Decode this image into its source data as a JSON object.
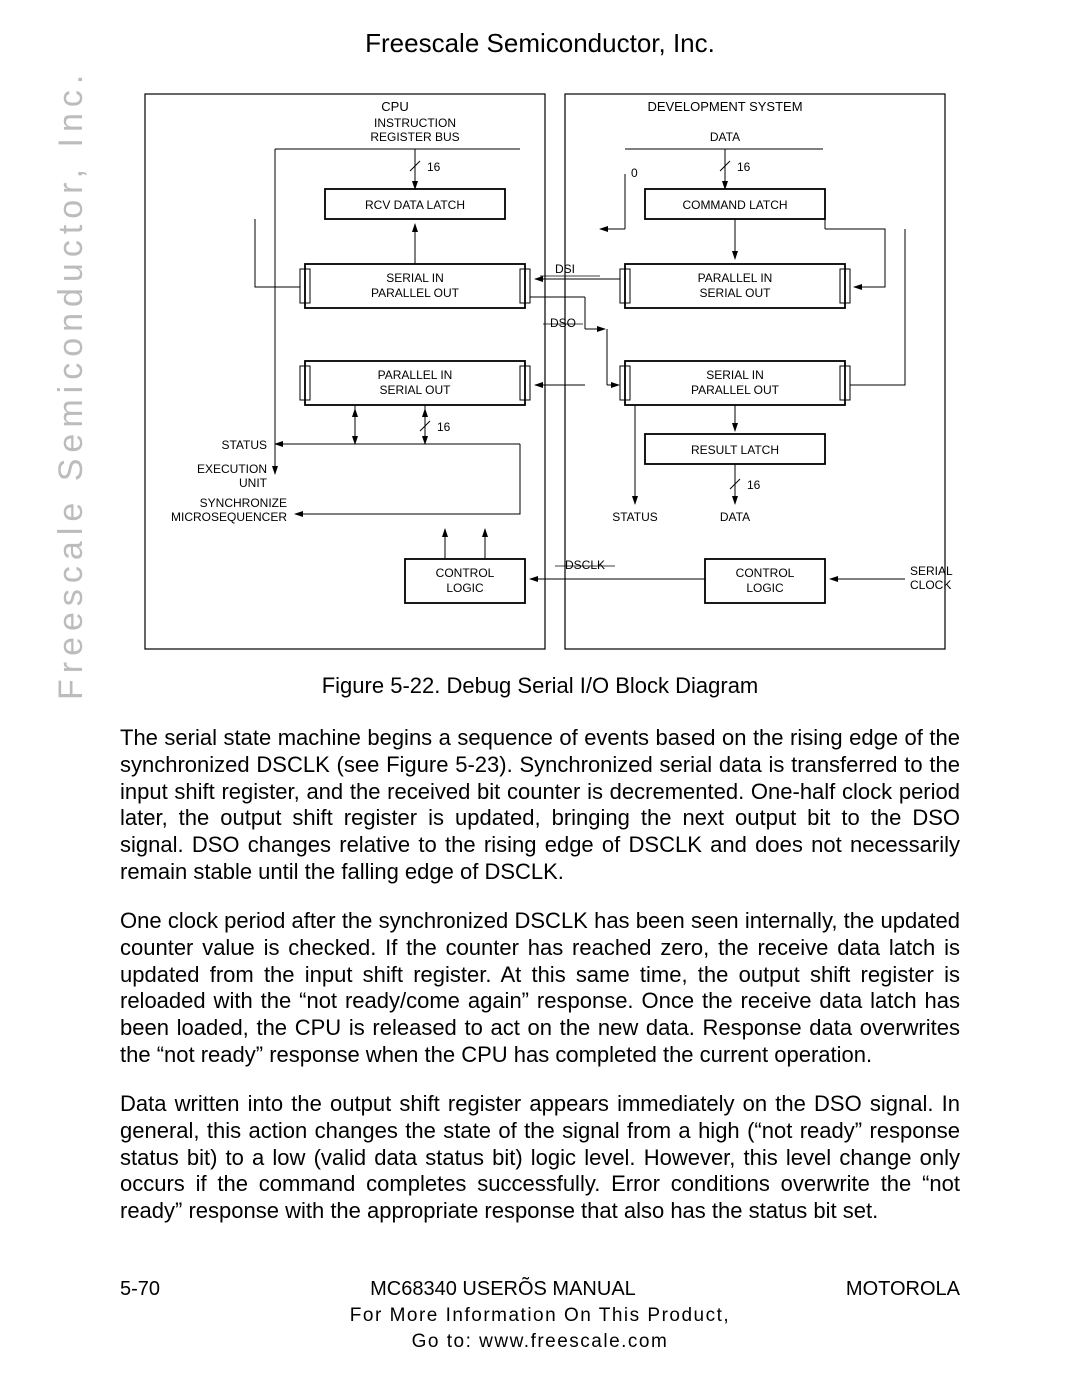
{
  "header": "Freescale Semiconductor, Inc.",
  "watermark": "Freescale Semiconductor, Inc.",
  "caption": "Figure 5-22. Debug Serial I/O Block Diagram",
  "diagram": {
    "left_title": "CPU",
    "right_title": "DEVELOPMENT SYSTEM",
    "instr_bus1": "INSTRUCTION",
    "instr_bus2": "REGISTER BUS",
    "bus_w_16a": "16",
    "zero": "0",
    "data_lbl": "DATA",
    "bus_w_16b": "16",
    "rcv_latch": "RCV DATA LATCH",
    "cmd_latch": "COMMAND LATCH",
    "si_po_l1": "SERIAL IN",
    "si_po_l2": "PARALLEL OUT",
    "pi_so_r1": "PARALLEL IN",
    "pi_so_r2": "SERIAL OUT",
    "dsi": "DSI",
    "dso": "DSO",
    "pi_so_l1": "PARALLEL IN",
    "pi_so_l2": "SERIAL OUT",
    "si_po_r1": "SERIAL IN",
    "si_po_r2": "PARALLEL OUT",
    "bus_w_16c": "16",
    "status": "STATUS",
    "exec_unit1": "EXECUTION",
    "exec_unit2": "UNIT",
    "sync1": "SYNCHRONIZE",
    "sync2": "MICROSEQUENCER",
    "result_latch": "RESULT LATCH",
    "bus_w_16d": "16",
    "status_r": "STATUS",
    "data_r": "DATA",
    "ctrl_logic_l1": "CONTROL",
    "ctrl_logic_l2": "LOGIC",
    "dsclk": "DSCLK",
    "ctrl_logic_r1": "CONTROL",
    "ctrl_logic_r2": "LOGIC",
    "serial_clk1": "SERIAL",
    "serial_clk2": "CLOCK"
  },
  "para1": "The serial state machine begins a sequence of events based on the rising edge of the synchronized DSCLK (see Figure 5-23). Synchronized serial data is transferred to the input shift register, and the received bit counter is decremented. One-half clock period later, the output shift register is updated, bringing the next output bit to the DSO signal. DSO changes relative to the rising edge of DSCLK and does not necessarily remain stable until the falling edge of DSCLK.",
  "para2": "One clock period after the synchronized DSCLK has been seen internally, the updated counter value is checked. If the counter has reached zero, the receive data latch is updated from the input shift register. At this same time, the output shift register is reloaded with the “not ready/come again” response. Once the receive data latch has been loaded, the CPU is released to act on the new data. Response data overwrites the “not ready” response when the CPU has completed the current operation.",
  "para3": "Data written into the output shift register appears immediately on the DSO signal. In general, this action changes the state of the signal from a high (“not ready” response status bit) to a low (valid data status bit) logic level. However, this level change only occurs if the command completes successfully. Error conditions overwrite the “not ready” response with the appropriate response that also has the status bit set.",
  "footer": {
    "page": "5-70",
    "manual": "MC68340 USERÕS MANUAL",
    "brand": "MOTOROLA",
    "info1": "For More Information On This Product,",
    "info2": "Go to: www.freescale.com"
  }
}
